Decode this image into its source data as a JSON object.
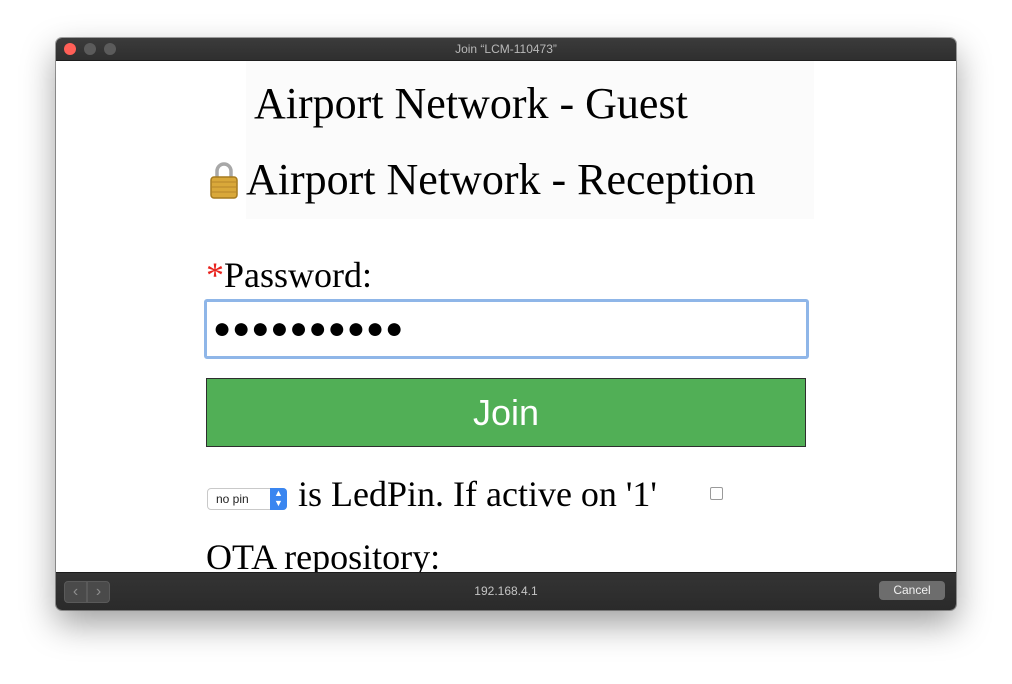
{
  "window": {
    "title": "Join “LCM-110473”"
  },
  "networks": [
    {
      "name": "Airport Network - Guest",
      "locked": false
    },
    {
      "name": "Airport Network - Reception",
      "locked": true
    }
  ],
  "password": {
    "required_marker": "*",
    "label": "Password:",
    "value_masked": "●●●●●●●●●●"
  },
  "join_button": {
    "label": "Join",
    "color": "#51af56"
  },
  "led": {
    "select_value": "no pin",
    "text": "is LedPin. If active on '1'",
    "checkbox_checked": false
  },
  "ota": {
    "label": "OTA repository:"
  },
  "bottom_bar": {
    "address": "192.168.4.1",
    "cancel_label": "Cancel"
  },
  "icons": [
    "lock-icon",
    "chevron-left-icon",
    "chevron-right-icon",
    "select-arrows-icon"
  ]
}
